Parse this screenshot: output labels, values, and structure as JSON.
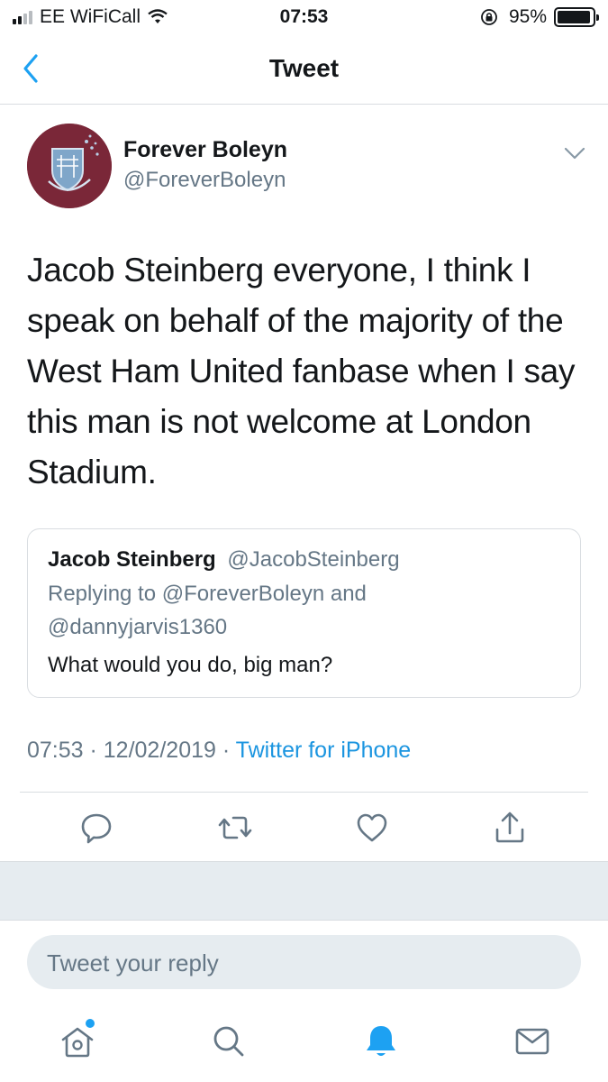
{
  "status_bar": {
    "carrier": "EE WiFiCall",
    "time": "07:53",
    "battery_percent": "95%",
    "battery_level": 0.95
  },
  "nav": {
    "title": "Tweet",
    "back_icon": "chevron-left-icon",
    "accent_color": "#1da1f2"
  },
  "tweet": {
    "author_name": "Forever Boleyn",
    "author_handle": "@ForeverBoleyn",
    "text": "Jacob Steinberg everyone, I think I speak on behalf of the majority of the West Ham United fanbase when I say this man is not welcome at London Stadium.",
    "timestamp": "07:53 · 12/02/2019 · ",
    "source": "Twitter for iPhone"
  },
  "quote": {
    "name": "Jacob Steinberg",
    "handle": "@JacobSteinberg",
    "replying_line1": "Replying to @ForeverBoleyn and",
    "replying_line2": "@dannyjarvis1360",
    "text": "What would you do, big man?"
  },
  "actions": {
    "icons": [
      "reply-icon",
      "retweet-icon",
      "like-icon",
      "share-icon"
    ]
  },
  "reply": {
    "placeholder": "Tweet your reply"
  },
  "tabbar": {
    "icons": [
      "home-icon",
      "search-icon",
      "notifications-icon",
      "messages-icon"
    ],
    "active": "notifications-icon"
  }
}
